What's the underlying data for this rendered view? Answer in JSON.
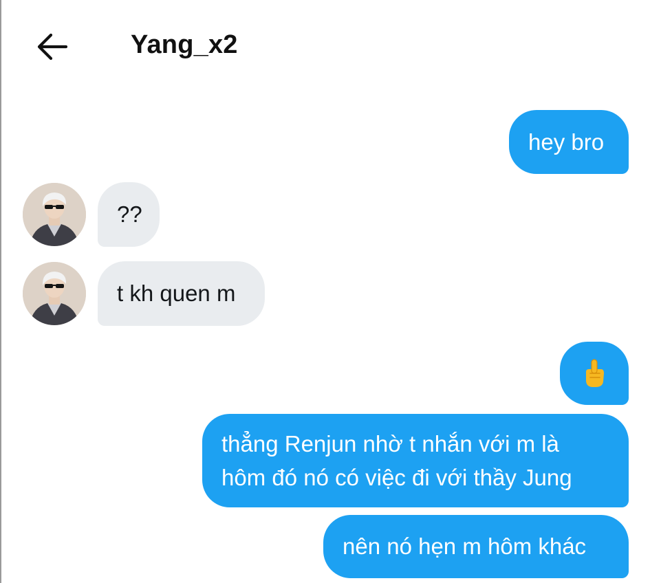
{
  "header": {
    "back_icon": "arrow-left-icon",
    "title": "Yang_x2"
  },
  "colors": {
    "outgoing_bubble": "#1da1f2",
    "incoming_bubble": "#e9ecef",
    "outgoing_text": "#ffffff",
    "incoming_text": "#14171a"
  },
  "messages": [
    {
      "direction": "outgoing",
      "text": "hey bro"
    },
    {
      "direction": "incoming",
      "text": "??",
      "avatar": "profile-avatar"
    },
    {
      "direction": "incoming",
      "text": "t kh quen m",
      "avatar": "profile-avatar"
    },
    {
      "direction": "outgoing",
      "emoji": "pointing-up-hand-emoji"
    },
    {
      "direction": "outgoing",
      "lines": [
        "thẳng Renjun nhờ t nhắn với m là",
        "hôm đó nó có việc đi với thầy Jung"
      ]
    },
    {
      "direction": "outgoing",
      "text": "nên nó hẹn m hôm khác"
    }
  ]
}
